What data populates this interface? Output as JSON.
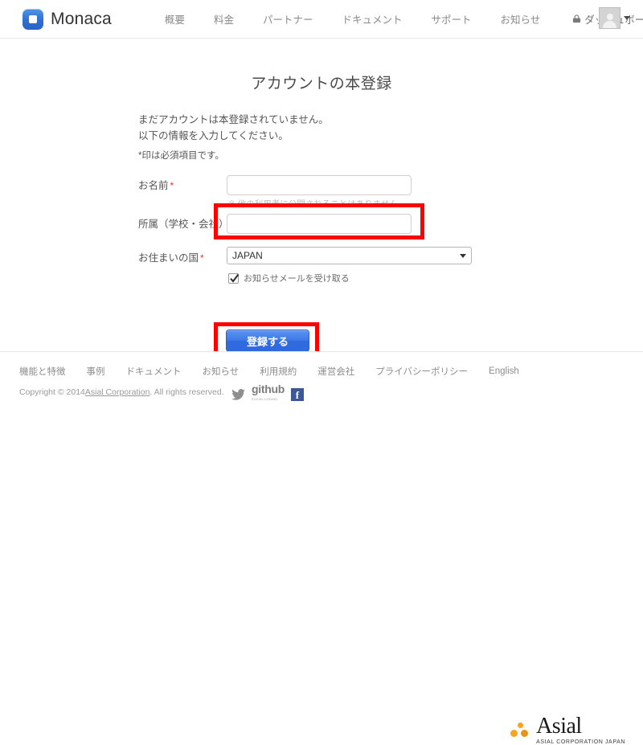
{
  "header": {
    "brand": "Monaca",
    "logo_icon": "monaca-logo-icon",
    "nav": [
      {
        "label": "概要"
      },
      {
        "label": "料金"
      },
      {
        "label": "パートナー"
      },
      {
        "label": "ドキュメント"
      },
      {
        "label": "サポート"
      },
      {
        "label": "お知らせ"
      }
    ],
    "dashboard": {
      "label": "ダッシュボード",
      "icon": "lock-icon"
    },
    "avatar": {
      "icon": "user-avatar-icon",
      "caret": "chevron-down-icon"
    }
  },
  "main": {
    "title": "アカウントの本登録",
    "intro_line1": "まだアカウントは本登録されていません。",
    "intro_line2": "以下の情報を入力してください。",
    "required_note": "*印は必須項目です。",
    "form": {
      "name": {
        "label": "お名前",
        "required_mark": "*",
        "value": "",
        "placeholder": "",
        "hint": "※ 他の利用者に公開されることはありません"
      },
      "affiliation": {
        "label": "所属（学校・会社）",
        "value": "",
        "placeholder": ""
      },
      "country": {
        "label": "お住まいの国",
        "required_mark": "*",
        "selected": "JAPAN",
        "arrow_icon": "chevron-down-icon"
      },
      "newsletter": {
        "label": "お知らせメールを受け取る",
        "checked": true
      },
      "submit_label": "登録する"
    }
  },
  "annotations": {
    "color": "#ff0000",
    "boxes": [
      {
        "name": "name-field-highlight"
      },
      {
        "name": "submit-button-highlight"
      }
    ]
  },
  "footer": {
    "links": [
      {
        "label": "機能と特徴"
      },
      {
        "label": "事例"
      },
      {
        "label": "ドキュメント"
      },
      {
        "label": "お知らせ"
      },
      {
        "label": "利用規約"
      },
      {
        "label": "運営会社"
      },
      {
        "label": "プライバシーポリシー"
      },
      {
        "label": "English"
      }
    ],
    "copyright_pre": "Copyright © 2014 ",
    "copyright_link": "Asial Corporation",
    "copyright_post": ". All rights reserved.",
    "social": [
      {
        "name": "twitter-icon"
      },
      {
        "name": "github-icon",
        "label": "github",
        "sub": "SOCIAL CODING"
      },
      {
        "name": "facebook-icon",
        "label": "f"
      }
    ],
    "asial": {
      "name": "Asial",
      "tagline": "ASIAL CORPORATION JAPAN"
    }
  }
}
